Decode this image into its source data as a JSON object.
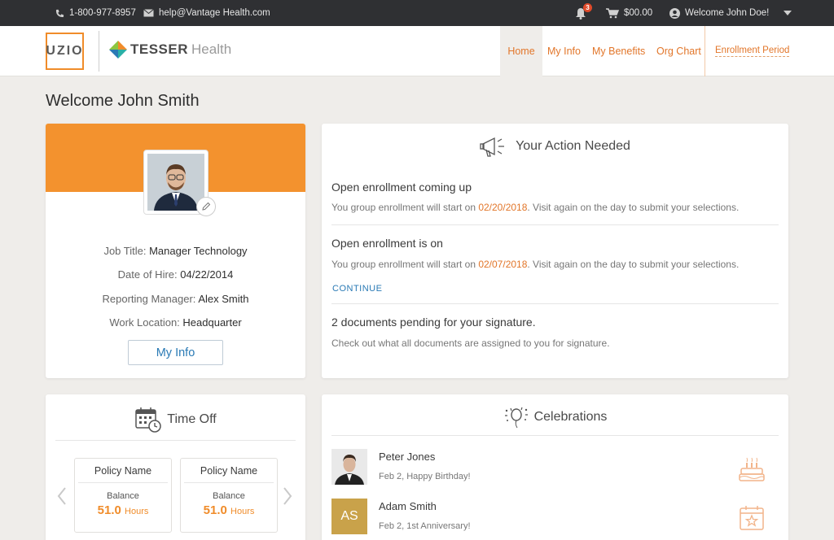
{
  "topbar": {
    "phone": "1-800-977-8957",
    "email": "help@Vantage Health.com",
    "notification_count": "3",
    "cart_amount": "$00.00",
    "welcome_text": "Welcome John Doe!"
  },
  "header": {
    "logo_uzio": "UZIO",
    "logo_tesser_bold": "TESSER",
    "logo_tesser_light": "Health",
    "nav": [
      {
        "label": "Home"
      },
      {
        "label": "My Info"
      },
      {
        "label": "My Benefits"
      },
      {
        "label": "Org Chart"
      }
    ],
    "enrollment_link": "Enrollment Period"
  },
  "page": {
    "welcome": "Welcome John Smith"
  },
  "profile": {
    "job_title_label": "Job Title:",
    "job_title": "Manager Technology",
    "hire_label": "Date of Hire:",
    "hire_date": "04/22/2014",
    "manager_label": "Reporting Manager:",
    "manager": "Alex Smith",
    "location_label": "Work Location:",
    "location": "Headquarter",
    "button": "My Info",
    "colors": {
      "band": "#f3922e"
    }
  },
  "action": {
    "title": "Your Action Needed",
    "items": [
      {
        "heading": "Open enrollment coming up",
        "text_before": "You group enrollment will start on ",
        "date": "02/20/2018",
        "text_after": ". Visit again on the day to submit your selections."
      },
      {
        "heading": "Open enrollment is on",
        "text_before": "You group enrollment will start on ",
        "date": "02/07/2018",
        "text_after": ". Visit again on the day to submit your selections.",
        "link": "CONTINUE"
      },
      {
        "heading": "2 documents pending for your signature.",
        "text": "Check out what all documents are assigned to you for signature."
      }
    ]
  },
  "timeoff": {
    "title": "Time Off",
    "policies": [
      {
        "name": "Policy Name",
        "balance_label": "Balance",
        "value": "51.0",
        "unit": "Hours"
      },
      {
        "name": "Policy Name",
        "balance_label": "Balance",
        "value": "51.0",
        "unit": "Hours"
      }
    ]
  },
  "celebrations": {
    "title": "Celebrations",
    "items": [
      {
        "name": "Peter Jones",
        "sub": "Feb 2, Happy Birthday!",
        "icon": "birthday-cake-icon"
      },
      {
        "name": "Adam Smith",
        "initials": "AS",
        "sub": "Feb 2, 1st Anniversary!",
        "icon": "calendar-star-icon"
      }
    ]
  }
}
